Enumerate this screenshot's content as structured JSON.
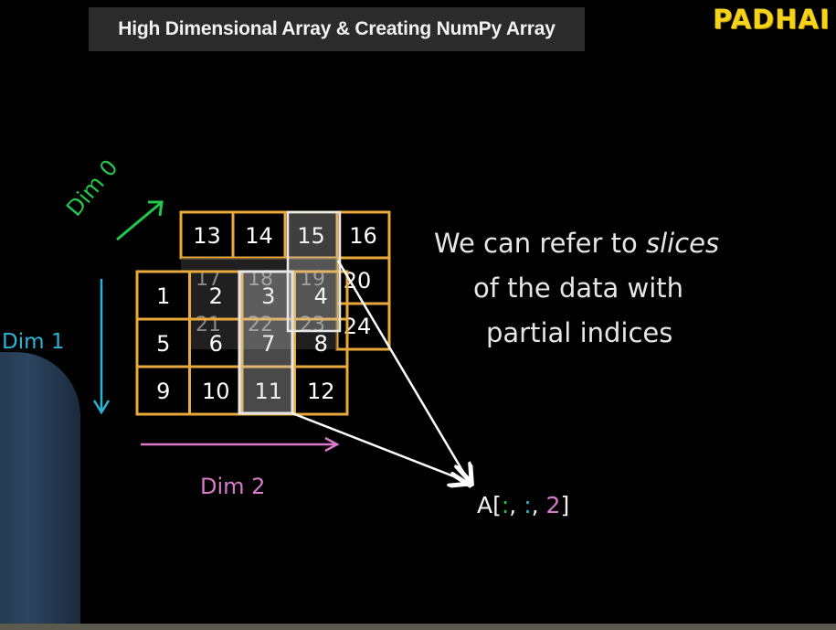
{
  "title": "High Dimensional Array & Creating NumPy Array",
  "logo": "PADHAI",
  "axes": {
    "dim0": "Dim 0",
    "dim1": "Dim 1",
    "dim2": "Dim 2"
  },
  "back_grid": [
    "13",
    "14",
    "15",
    "16",
    "17",
    "18",
    "19",
    "20",
    "21",
    "22",
    "23",
    "24"
  ],
  "front_grid": [
    "1",
    "2",
    "3",
    "4",
    "5",
    "6",
    "7",
    "8",
    "9",
    "10",
    "11",
    "12"
  ],
  "caption": {
    "line1_start": "We can refer to ",
    "line1_emph": "slices",
    "line2": "of the data with",
    "line3": "partial indices"
  },
  "slice_expr": {
    "prefix": "A[",
    "part1": ":",
    "sep1": ", ",
    "part2": ":",
    "sep2": ", ",
    "part3": "2",
    "suffix": "]"
  },
  "colors": {
    "grid_border": "#e9a93c",
    "dim0": "#22c84a",
    "dim1": "#2ab4d6",
    "dim2": "#d979c9",
    "highlight": "#d0d0d0",
    "arrow": "#ffffff"
  }
}
